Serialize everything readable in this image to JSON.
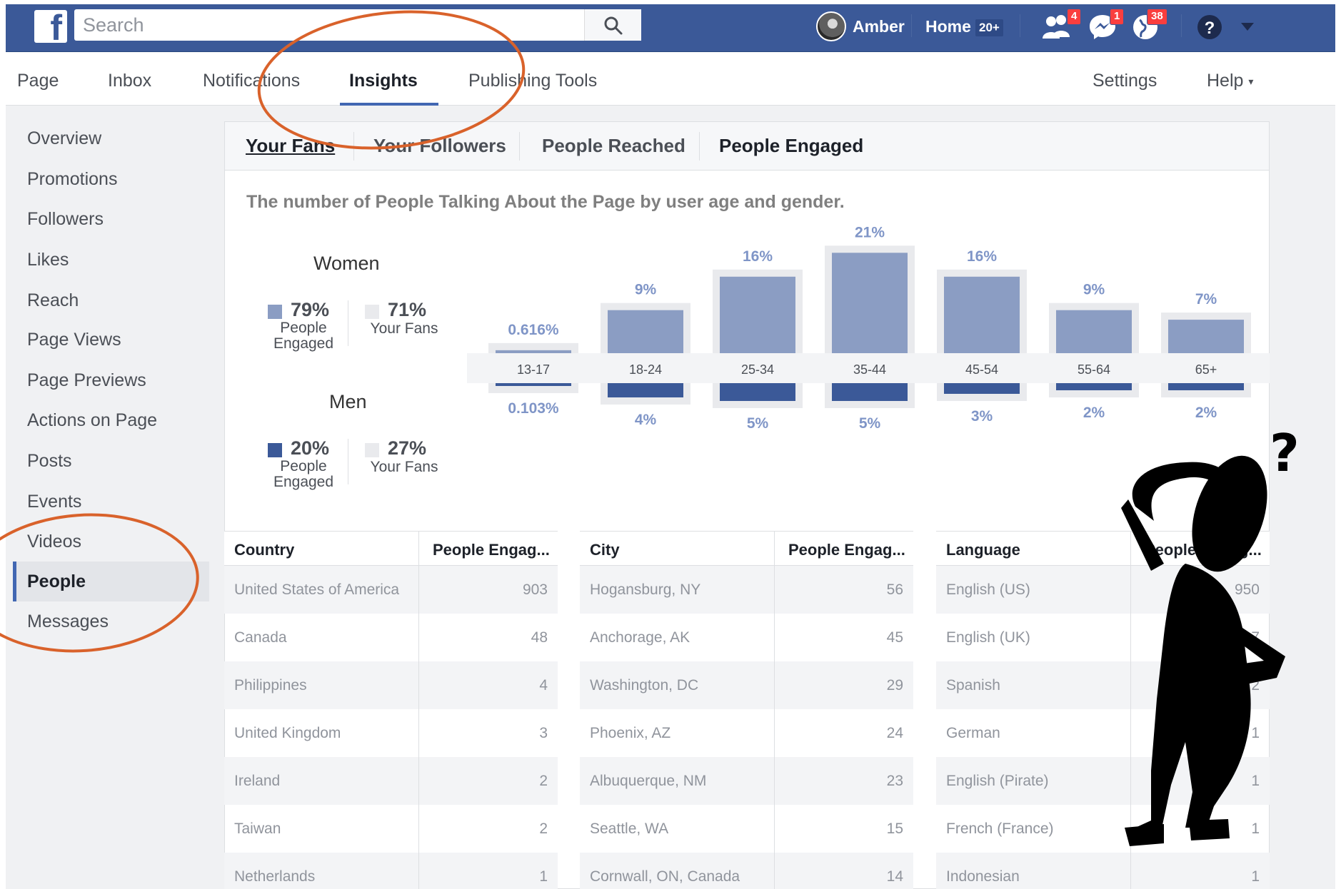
{
  "topbar": {
    "search_placeholder": "Search",
    "user_name": "Amber",
    "home_label": "Home",
    "home_badge": "20+",
    "friend_requests_count": "4",
    "messages_count": "1",
    "notifications_count": "38"
  },
  "page_nav": {
    "items": [
      "Page",
      "Inbox",
      "Notifications",
      "Insights",
      "Publishing Tools"
    ],
    "active": "Insights",
    "settings": "Settings",
    "help": "Help"
  },
  "sidebar": {
    "items": [
      "Overview",
      "Promotions",
      "Followers",
      "Likes",
      "Reach",
      "Page Views",
      "Page Previews",
      "Actions on Page",
      "Posts",
      "Events",
      "Videos",
      "People",
      "Messages"
    ],
    "active": "People"
  },
  "tabs": [
    "Your Fans",
    "Your Followers",
    "People Reached",
    "People Engaged"
  ],
  "description": "The number of People Talking About the Page by user age and gender.",
  "women": {
    "title": "Women",
    "engaged_pct": "79%",
    "engaged_label_1": "People",
    "engaged_label_2": "Engaged",
    "fans_pct": "71%",
    "fans_label": "Your Fans"
  },
  "men": {
    "title": "Men",
    "engaged_pct": "20%",
    "engaged_label_1": "People",
    "engaged_label_2": "Engaged",
    "fans_pct": "27%",
    "fans_label": "Your Fans"
  },
  "colors": {
    "facebook_blue": "#3b5998",
    "women_bar": "#8b9dc3",
    "men_bar": "#3b5998",
    "fans_bar": "#e9eaed",
    "annotation": "#d9622b"
  },
  "chart_data": {
    "type": "bar",
    "categories": [
      "13-17",
      "18-24",
      "25-34",
      "35-44",
      "45-54",
      "55-64",
      "65+"
    ],
    "series": [
      {
        "name": "Women",
        "values": [
          0.616,
          9,
          16,
          21,
          16,
          9,
          7
        ],
        "labels": [
          "0.616%",
          "9%",
          "16%",
          "21%",
          "16%",
          "9%",
          "7%"
        ]
      },
      {
        "name": "Men",
        "values": [
          0.103,
          4,
          5,
          5,
          3,
          2,
          2
        ],
        "labels": [
          "0.103%",
          "4%",
          "5%",
          "5%",
          "3%",
          "2%",
          "2%"
        ]
      }
    ]
  },
  "tables": {
    "country": {
      "headers": [
        "Country",
        "People Engag..."
      ],
      "rows": [
        [
          "United States of America",
          "903"
        ],
        [
          "Canada",
          "48"
        ],
        [
          "Philippines",
          "4"
        ],
        [
          "United Kingdom",
          "3"
        ],
        [
          "Ireland",
          "2"
        ],
        [
          "Taiwan",
          "2"
        ],
        [
          "Netherlands",
          "1"
        ]
      ]
    },
    "city": {
      "headers": [
        "City",
        "People Engag..."
      ],
      "rows": [
        [
          "Hogansburg, NY",
          "56"
        ],
        [
          "Anchorage, AK",
          "45"
        ],
        [
          "Washington, DC",
          "29"
        ],
        [
          "Phoenix, AZ",
          "24"
        ],
        [
          "Albuquerque, NM",
          "23"
        ],
        [
          "Seattle, WA",
          "15"
        ],
        [
          "Cornwall, ON, Canada",
          "14"
        ]
      ]
    },
    "language": {
      "headers": [
        "Language",
        "People Engag..."
      ],
      "rows": [
        [
          "English (US)",
          "950"
        ],
        [
          "English (UK)",
          "17"
        ],
        [
          "Spanish",
          "2"
        ],
        [
          "German",
          "1"
        ],
        [
          "English (Pirate)",
          "1"
        ],
        [
          "French (France)",
          "1"
        ],
        [
          "Indonesian",
          "1"
        ]
      ]
    }
  },
  "annotation": {
    "question_mark": "?"
  }
}
